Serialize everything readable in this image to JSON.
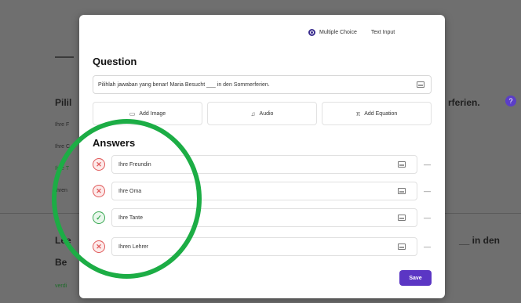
{
  "background": {
    "title_fragment_left": "Pilil",
    "title_fragment_right": "rferien.",
    "badge": "?",
    "lines_left": [
      "Ihre F",
      "Ihre C",
      "Ihre T",
      "Ihren"
    ],
    "heading2_left": "Lee",
    "heading2_left2": "Be",
    "heading2_right": "__ in den",
    "footer_small": "verdi"
  },
  "modal": {
    "question_types": [
      {
        "label": "Multiple Choice",
        "selected": true
      },
      {
        "label": "Text Input",
        "selected": false
      }
    ],
    "question_heading": "Question",
    "question_text": "Pilihlah jawaban yang benar! Maria Besucht ___ in den Sommerferien.",
    "media_buttons": [
      {
        "icon": "image-icon",
        "glyph": "▭",
        "label": "Add Image"
      },
      {
        "icon": "audio-icon",
        "glyph": "♫",
        "label": "Audio"
      },
      {
        "icon": "equation-icon",
        "glyph": "π",
        "label": "Add Equation"
      }
    ],
    "answers_heading": "Answers",
    "answers": [
      {
        "text": "Ihre Freundin",
        "status": "wrong",
        "mark": "✕"
      },
      {
        "text": "Ihre Oma",
        "status": "wrong",
        "mark": "✕"
      },
      {
        "text": "Ihre Tante",
        "status": "correct",
        "mark": "✓"
      },
      {
        "text": "Ihren Lehrer",
        "status": "wrong",
        "mark": "✕"
      }
    ],
    "more_glyph": "—",
    "save_label": "Save"
  },
  "colors": {
    "accent": "#5b36c4",
    "correct": "#3aa853",
    "wrong": "#e05a5a",
    "annotation": "#1cad45"
  }
}
